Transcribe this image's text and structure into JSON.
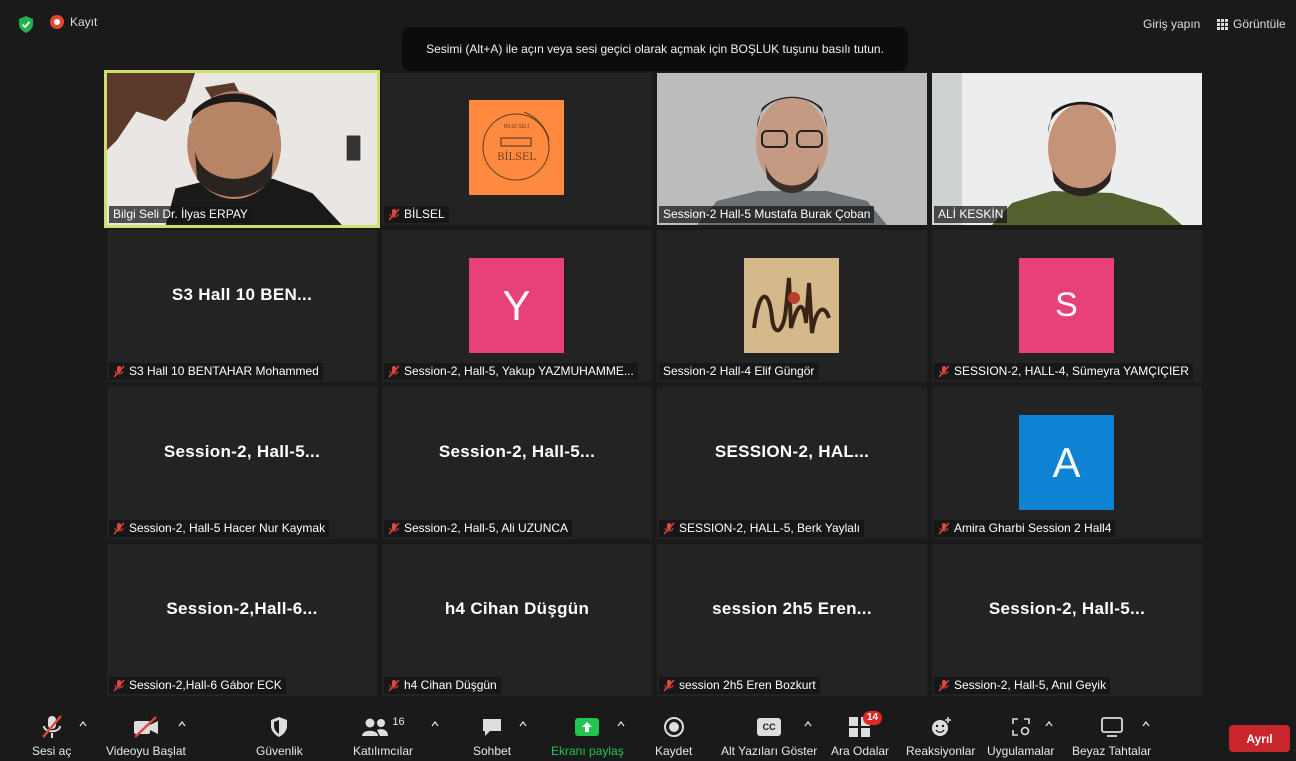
{
  "topbar": {
    "record_label": "Kayıt",
    "login_label": "Giriş yapın",
    "view_label": "Görüntüle"
  },
  "tooltip": "Sesimi (Alt+A) ile açın veya sesi geçici olarak açmak için BOŞLUK tuşunu basılı tutun.",
  "participants": [
    {
      "label": "Bilgi Seli Dr. İlyas ERPAY",
      "muted": false,
      "active": true
    },
    {
      "label": "BİLSEL",
      "muted": true,
      "logo_text": "BİLSEL",
      "logo_top": "BİLGİ SELİ"
    },
    {
      "label": "Session-2 Hall-5 Mustafa Burak Çoban",
      "muted": false
    },
    {
      "label": "ALİ KESKİN",
      "muted": false
    },
    {
      "label": "S3  Hall 10  BENTAHAR Mohammed",
      "muted": true,
      "display": "S3  Hall 10  BEN..."
    },
    {
      "label": "Session-2, Hall-5, Yakup YAZMUHAMME...",
      "muted": true,
      "avatar": "Y"
    },
    {
      "label": "Session-2 Hall-4 Elif Güngör",
      "muted": false
    },
    {
      "label": "SESSION-2, HALL-4, Sümeyra YAMÇIÇIER",
      "muted": true,
      "avatar": "S"
    },
    {
      "label": "Session-2, Hall-5 Hacer Nur Kaymak",
      "muted": true,
      "display": "Session-2,  Hall-5..."
    },
    {
      "label": "Session-2, Hall-5, Ali UZUNCA",
      "muted": true,
      "display": "Session-2,  Hall-5..."
    },
    {
      "label": "SESSION-2, HALL-5, Berk Yaylalı",
      "muted": true,
      "display": "SESSION-2,  HAL..."
    },
    {
      "label": "Amira Gharbi Session 2 Hall4",
      "muted": true,
      "avatar": "A"
    },
    {
      "label": "Session-2,Hall-6 Gábor ECK",
      "muted": true,
      "display": "Session-2,Hall-6..."
    },
    {
      "label": "h4 Cihan Düşgün",
      "muted": true,
      "display": "h4 Cihan Düşgün"
    },
    {
      "label": "session 2h5 Eren Bozkurt",
      "muted": true,
      "display": "session 2h5 Eren..."
    },
    {
      "label": "Session-2, Hall-5, Anıl Geyik",
      "muted": true,
      "display": "Session-2,  Hall-5..."
    }
  ],
  "colors": {
    "avatar_pink": "#e8417a",
    "avatar_blue": "#0e83d4",
    "active_border": "#cfe06a",
    "leave_red": "#c9252c",
    "share_green": "#23c552"
  },
  "toolbar": {
    "unmute": "Sesi aç",
    "start_video": "Videoyu Başlat",
    "security": "Güvenlik",
    "participants": "Katılımcılar",
    "participants_count": "16",
    "chat": "Sohbet",
    "share_screen": "Ekranı paylaş",
    "record": "Kaydet",
    "captions": "Alt Yazıları Göster",
    "captions_icon_text": "CC",
    "breakout": "Ara Odalar",
    "breakout_count": "14",
    "reactions": "Reaksiyonlar",
    "apps": "Uygulamalar",
    "whiteboards": "Beyaz Tahtalar",
    "leave": "Ayrıl"
  }
}
